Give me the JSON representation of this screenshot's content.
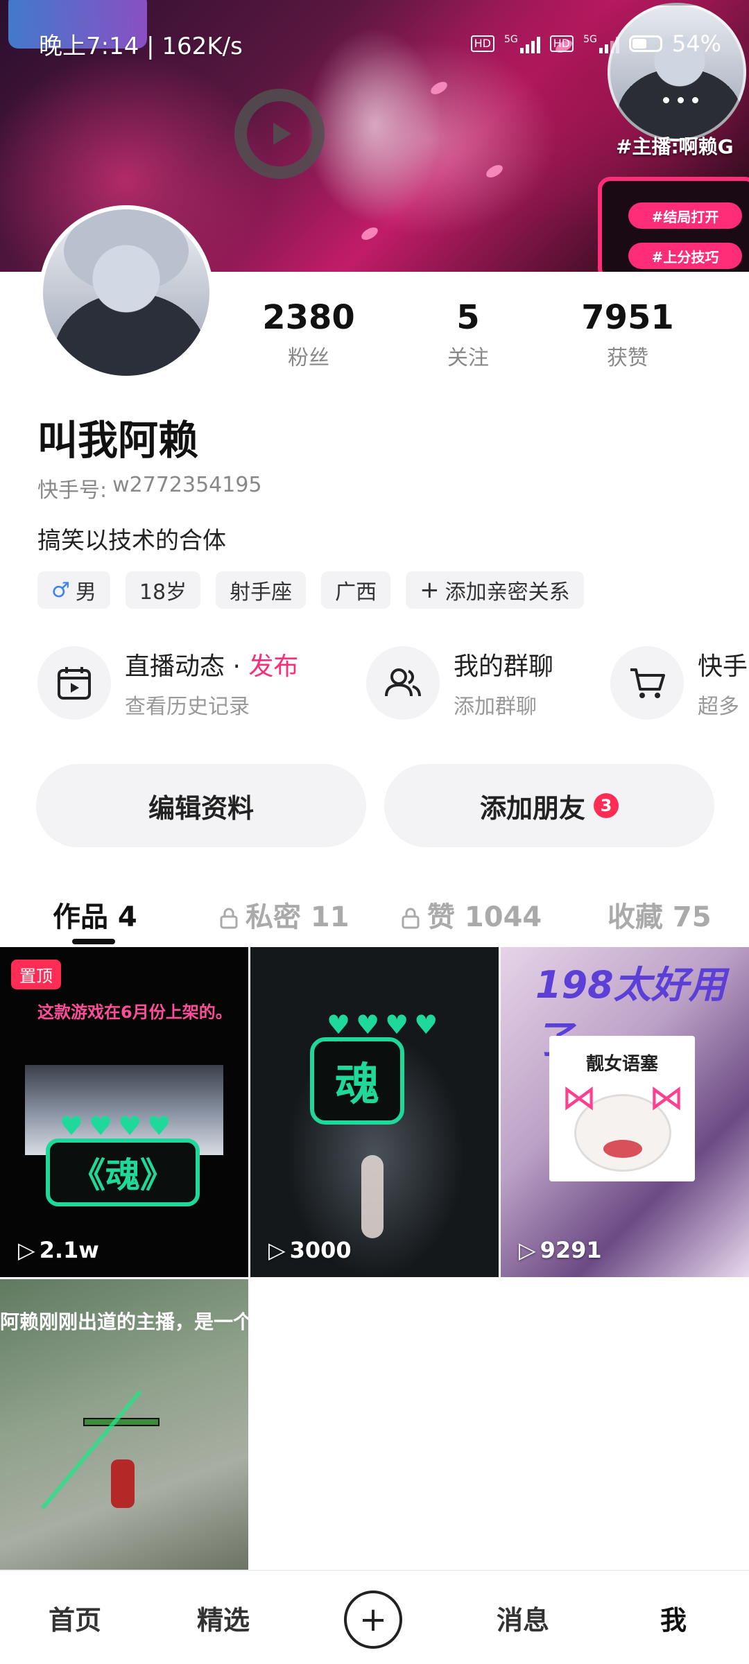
{
  "status_bar": {
    "time": "晚上7:14 | 162K/s",
    "network_1": "5G",
    "network_2": "5G",
    "hd": "HD",
    "battery": "54%"
  },
  "banner": {
    "anchor_tag": "#主播:啊赖G",
    "chip_1": "#结局打开",
    "chip_2": "#上分技巧"
  },
  "profile": {
    "stats": [
      {
        "value": "2380",
        "label": "粉丝"
      },
      {
        "value": "5",
        "label": "关注"
      },
      {
        "value": "7951",
        "label": "获赞"
      }
    ],
    "name": "叫我阿赖",
    "uid_label": "快手号:",
    "uid_value": "w2772354195",
    "bio": "搞笑以技术的合体",
    "tags": [
      "男",
      "18岁",
      "射手座",
      "广西",
      "添加亲密关系"
    ]
  },
  "features": [
    {
      "title": "直播动态",
      "separator": " · ",
      "accent": "发布",
      "subtitle": "查看历史记录"
    },
    {
      "title": "我的群聊",
      "subtitle": "添加群聊"
    },
    {
      "title": "快手",
      "subtitle": "超多"
    }
  ],
  "actions": {
    "edit_profile": "编辑资料",
    "add_friends": "添加朋友",
    "add_friends_badge": "3"
  },
  "tabs": [
    {
      "label": "作品 4"
    },
    {
      "label": "私密 11"
    },
    {
      "label": "赞 1044"
    },
    {
      "label": "收藏 75"
    }
  ],
  "videos": [
    {
      "views": "2.1w",
      "pinned": "置顶",
      "caption": "这款游戏在6月份上架的。",
      "title": "《魂》"
    },
    {
      "views": "3000",
      "title": "魂"
    },
    {
      "views": "9291",
      "title": "198太好用了",
      "card_label": "靓女语塞"
    },
    {
      "caption": "阿赖刚刚出道的主播，是一个"
    }
  ],
  "bottom_nav": {
    "home": "首页",
    "featured": "精选",
    "plus": "+",
    "messages": "消息",
    "me": "我"
  }
}
